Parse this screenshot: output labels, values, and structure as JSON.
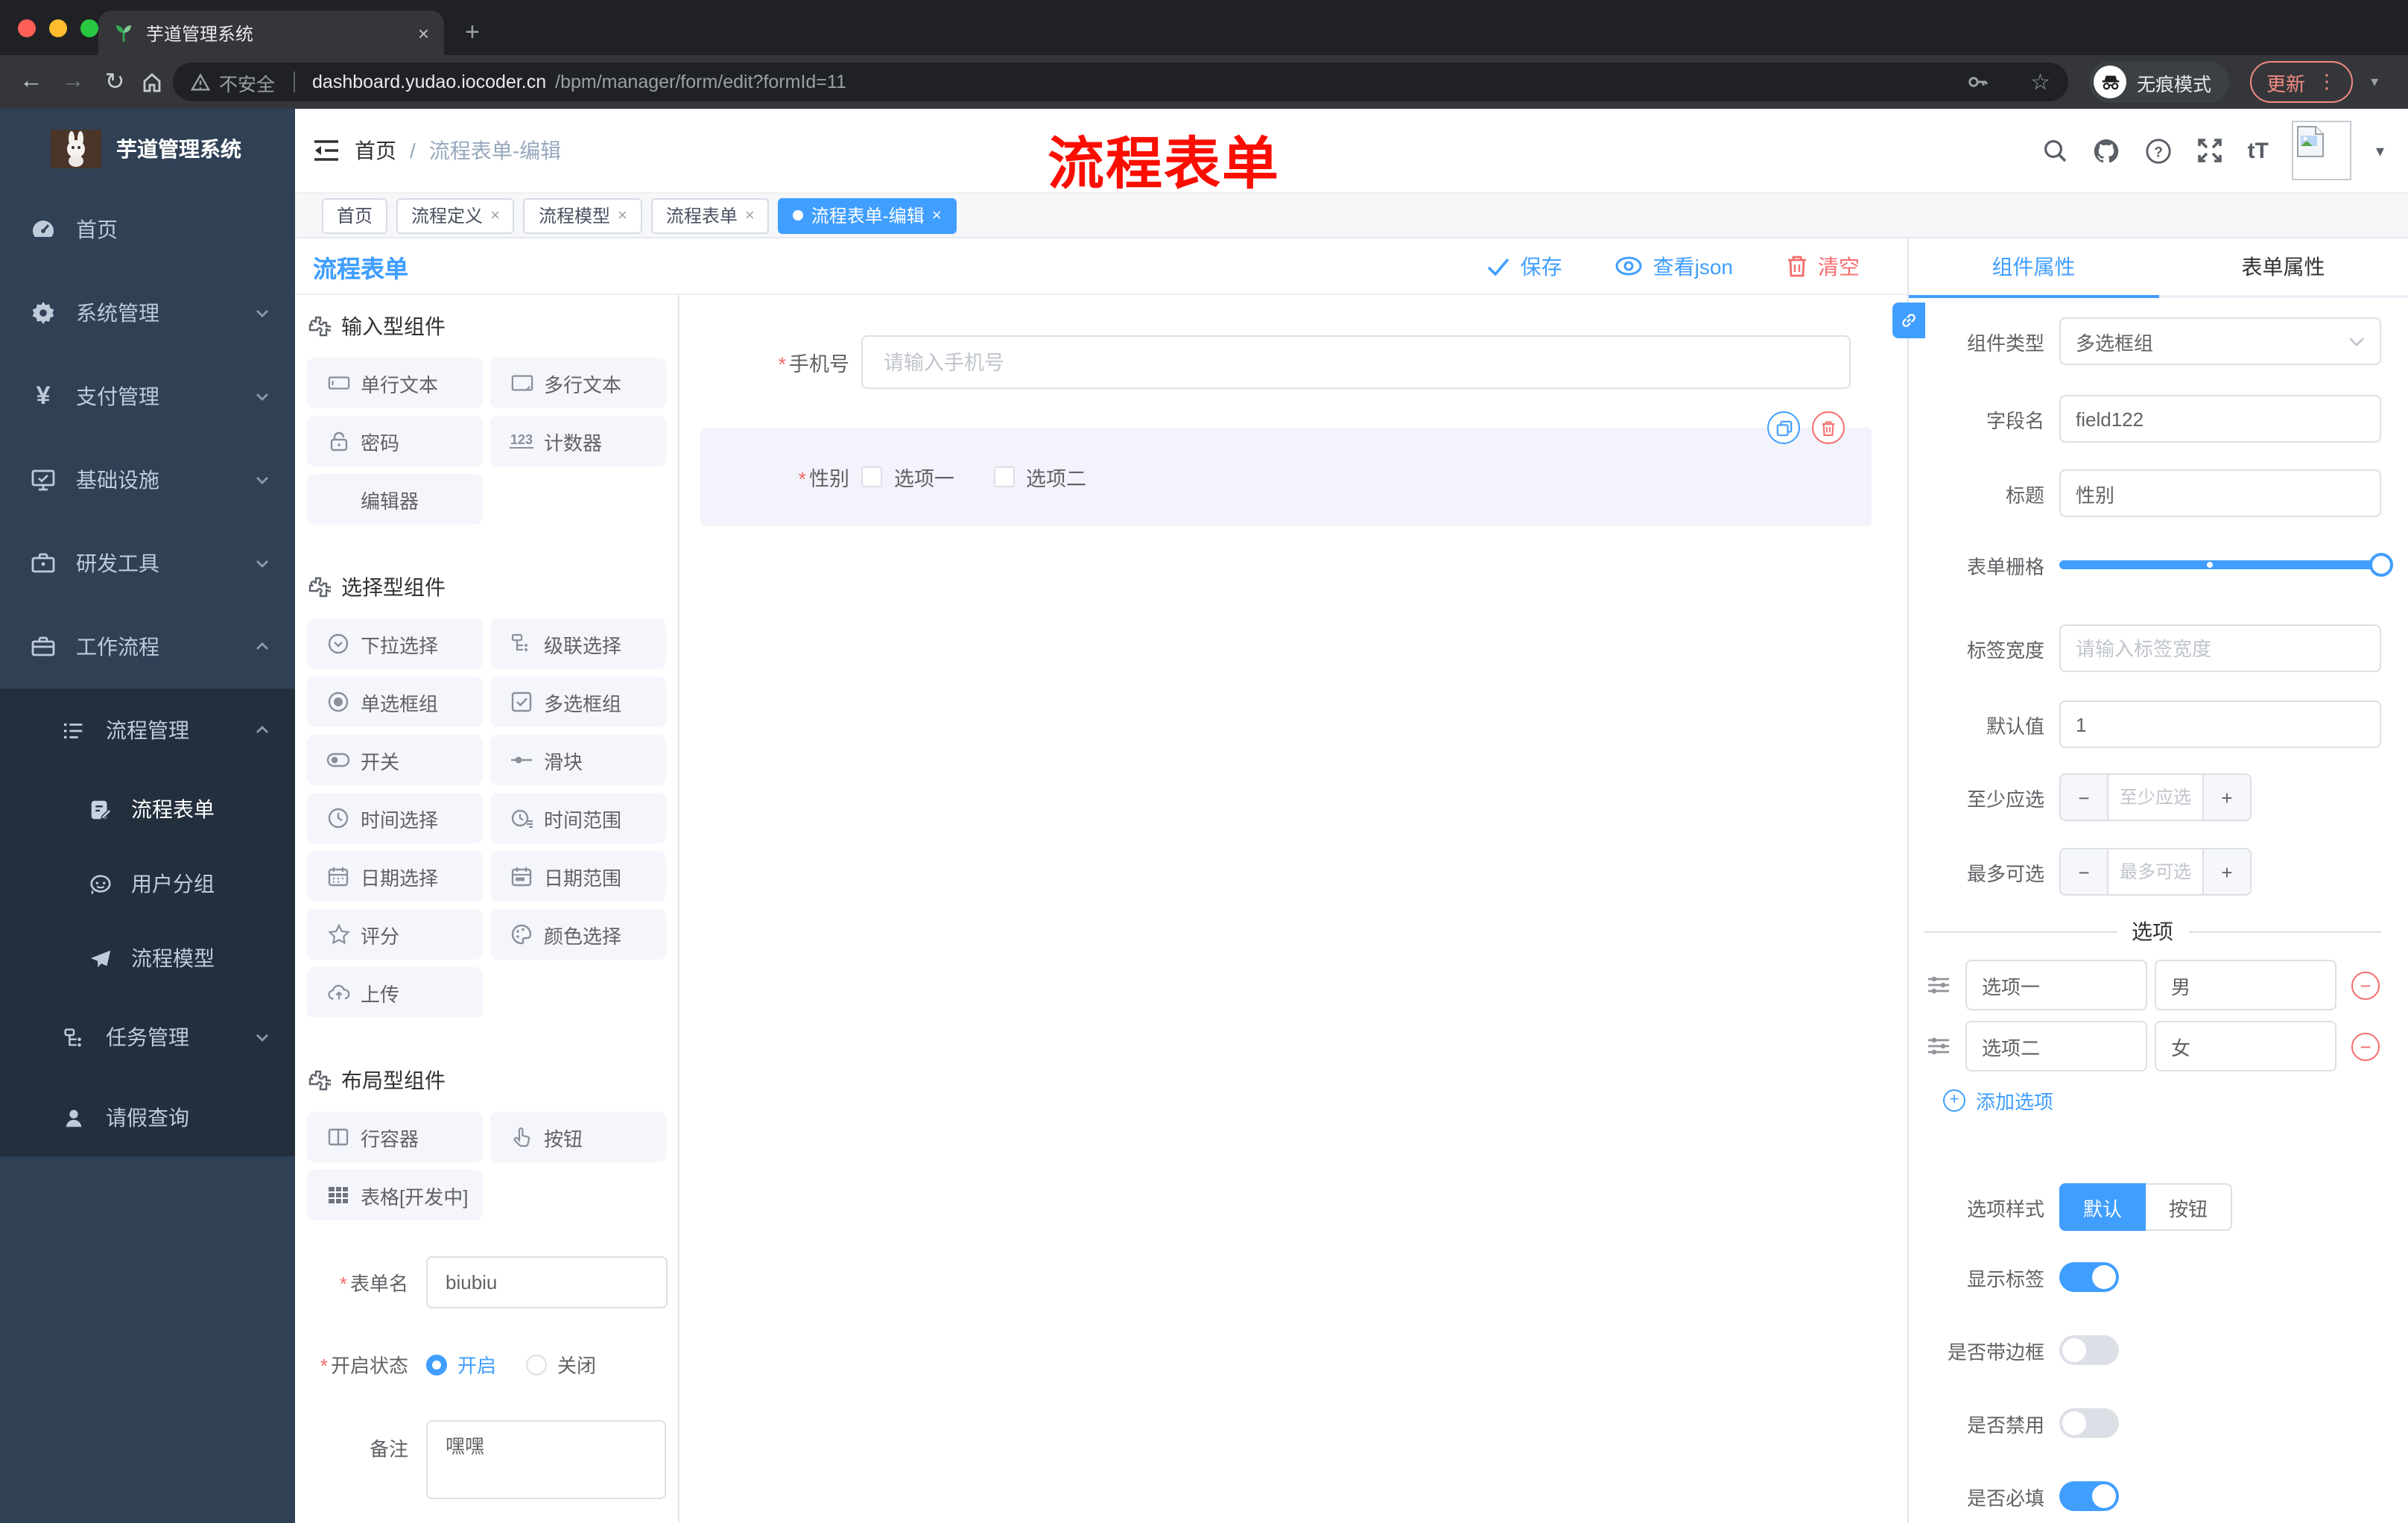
{
  "icons": {
    "close": "×",
    "minus": "−",
    "plus": "+",
    "dots": "⋮",
    "caret": "▾",
    "back": "←",
    "forward": "→",
    "reload": "↻",
    "star": "☆",
    "yen": "¥",
    "newtab": "+",
    "tT": "tT",
    "question": "?"
  },
  "browser": {
    "tab_title": "芋道管理系统",
    "security_label": "不安全",
    "url_host": "dashboard.yudao.iocoder.cn",
    "url_path": "/bpm/manager/form/edit?formId=11",
    "incognito_label": "无痕模式",
    "update_label": "更新"
  },
  "sidebar": {
    "brand": "芋道管理系统",
    "items": [
      {
        "label": "首页"
      },
      {
        "label": "系统管理"
      },
      {
        "label": "支付管理"
      },
      {
        "label": "基础设施"
      },
      {
        "label": "研发工具"
      },
      {
        "label": "工作流程"
      }
    ],
    "process_mgmt": {
      "label": "流程管理"
    },
    "children": [
      {
        "label": "流程表单"
      },
      {
        "label": "用户分组"
      },
      {
        "label": "流程模型"
      }
    ],
    "task_mgmt": {
      "label": "任务管理"
    },
    "leave_query": {
      "label": "请假查询"
    }
  },
  "header": {
    "breadcrumb_home": "首页",
    "breadcrumb_sep": "/",
    "breadcrumb_current": "流程表单-编辑",
    "annotation": "流程表单"
  },
  "tags": [
    {
      "label": "首页"
    },
    {
      "label": "流程定义"
    },
    {
      "label": "流程模型"
    },
    {
      "label": "流程表单"
    },
    {
      "label": "流程表单-编辑"
    }
  ],
  "toolbar": {
    "title": "流程表单",
    "save": "保存",
    "view_json": "查看json",
    "clear": "清空"
  },
  "palette": {
    "section1": {
      "title": "输入型组件",
      "items": [
        "单行文本",
        "多行文本",
        "密码",
        "计数器",
        "编辑器"
      ]
    },
    "section2": {
      "title": "选择型组件",
      "items": [
        "下拉选择",
        "级联选择",
        "单选框组",
        "多选框组",
        "开关",
        "滑块",
        "时间选择",
        "时间范围",
        "日期选择",
        "日期范围",
        "评分",
        "颜色选择",
        "上传"
      ]
    },
    "section3": {
      "title": "布局型组件",
      "items": [
        "行容器",
        "按钮",
        "表格[开发中]"
      ]
    }
  },
  "form_meta": {
    "name_label": "表单名",
    "name_value": "biubiu",
    "status_label": "开启状态",
    "status_on": "开启",
    "status_off": "关闭",
    "remark_label": "备注",
    "remark_value": "嘿嘿"
  },
  "canvas": {
    "phone_label": "手机号",
    "phone_placeholder": "请输入手机号",
    "gender_label": "性别",
    "gender_opt1": "选项一",
    "gender_opt2": "选项二"
  },
  "props": {
    "tab_component": "组件属性",
    "tab_form": "表单属性",
    "type_label": "组件类型",
    "type_value": "多选框组",
    "field_label": "字段名",
    "field_value": "field122",
    "title_label": "标题",
    "title_value": "性别",
    "grid_label": "表单栅格",
    "width_label": "标签宽度",
    "width_placeholder": "请输入标签宽度",
    "default_label": "默认值",
    "default_value": "1",
    "min_label": "至少应选",
    "min_placeholder": "至少应选",
    "max_label": "最多可选",
    "max_placeholder": "最多可选",
    "options_divider": "选项",
    "option1_label": "选项一",
    "option1_value": "男",
    "option2_label": "选项二",
    "option2_value": "女",
    "add_option": "添加选项",
    "style_label": "选项样式",
    "style_default": "默认",
    "style_button": "按钮",
    "show_label": "显示标签",
    "border_label": "是否带边框",
    "disabled_label": "是否禁用",
    "required_label": "是否必填"
  }
}
